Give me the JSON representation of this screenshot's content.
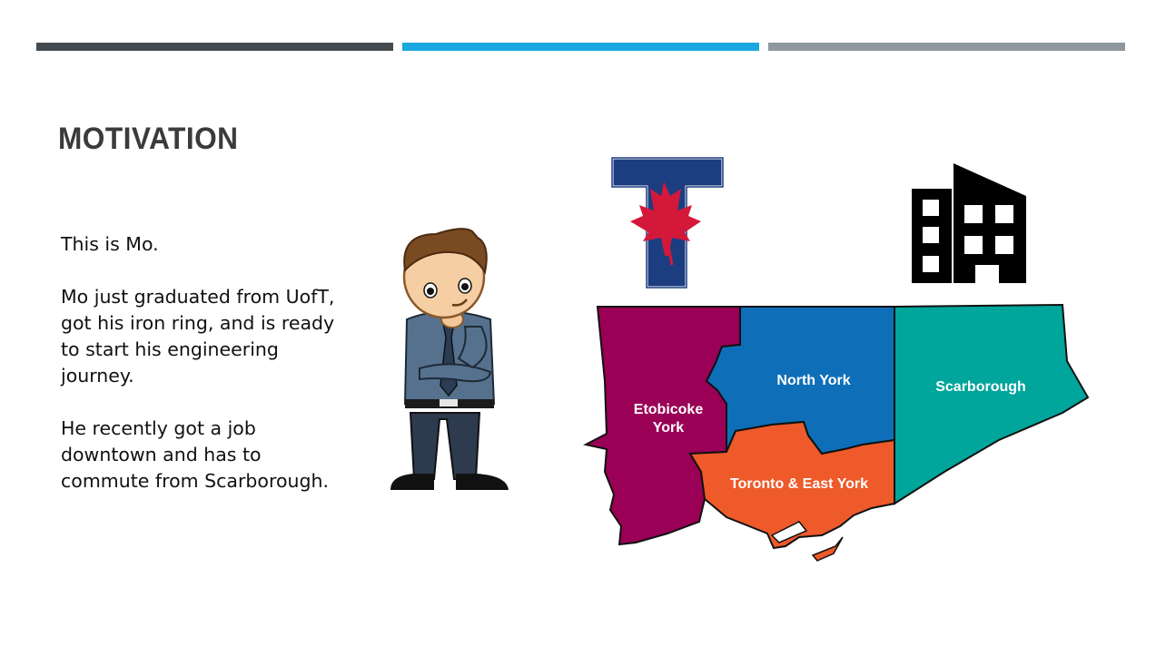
{
  "slide": {
    "title": "MOTIVATION",
    "paragraphs": [
      "This is Mo.",
      "Mo just graduated from UofT, got his iron ring, and is ready to start his engineering journey.",
      "He recently got a job downtown and has to commute from Scarborough."
    ]
  },
  "map": {
    "regions": {
      "etobicoke_line1": "Etobicoke",
      "etobicoke_line2": "York",
      "north_york": "North York",
      "scarborough": "Scarborough",
      "toronto_east_york": "Toronto & East York"
    },
    "colors": {
      "etobicoke": "#9a0055",
      "north_york": "#0e6fb8",
      "scarborough": "#00a59b",
      "toronto_east_york": "#ee5a2a"
    }
  },
  "icons": [
    "person-thinking-icon",
    "uoft-logo-icon",
    "office-building-icon"
  ],
  "accent_colors": {
    "bar_dark": "#444b50",
    "bar_blue": "#1aa8e0",
    "bar_gray": "#8d989f"
  }
}
